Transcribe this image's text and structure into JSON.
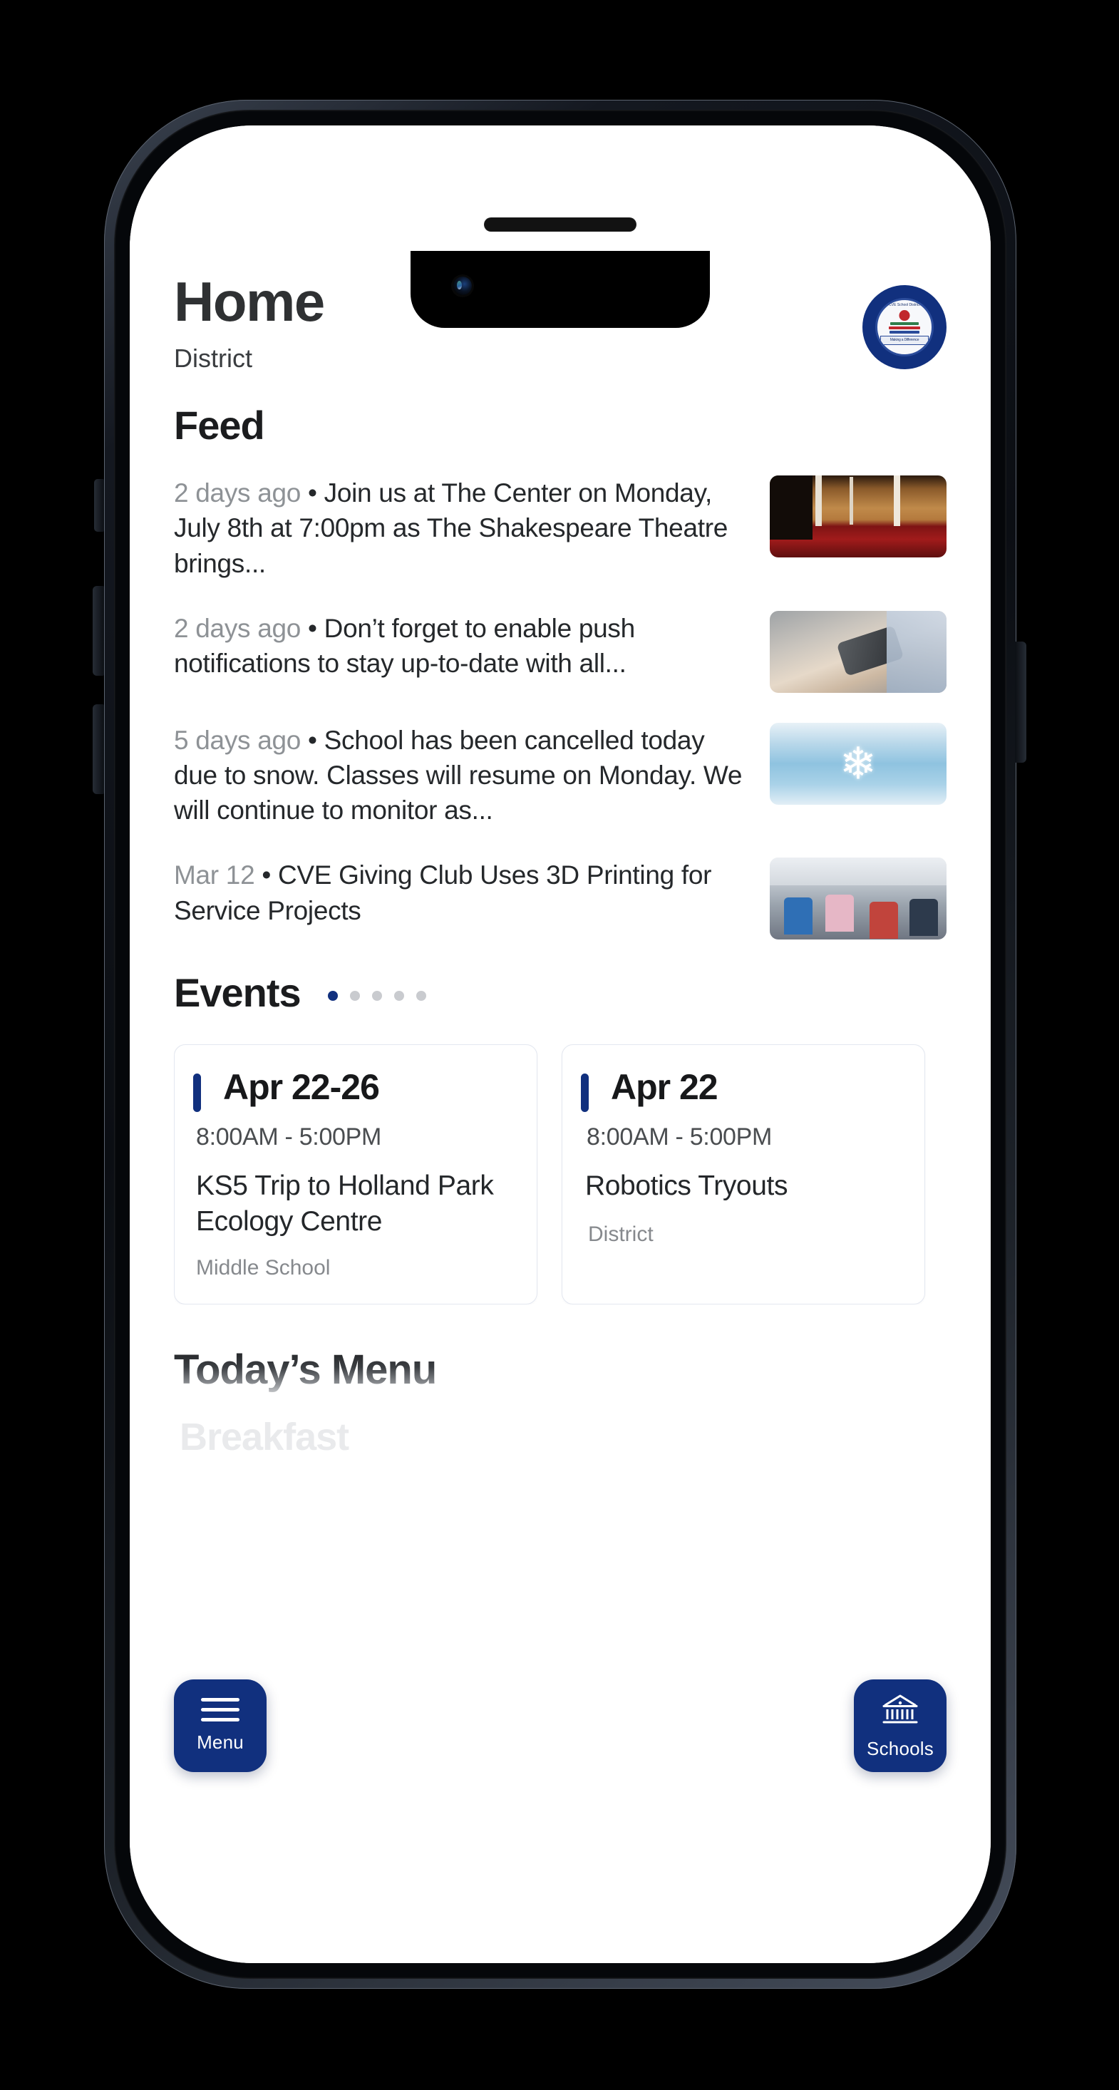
{
  "app": {
    "header": {
      "title": "Home",
      "subtitle": "District",
      "avatar_icon": "school-crest-logo",
      "crest_arc_text": "CVE School District",
      "crest_banner_text": "Making a Difference"
    },
    "feed": {
      "section_title": "Feed",
      "bullet": "•",
      "items": [
        {
          "date": "2 days ago",
          "text": "Join us at The Center on Monday, July 8th at 7:00pm as The Shakespeare Theatre brings...",
          "thumb_icon": "theatre-auditorium-thumbnail"
        },
        {
          "date": "2 days ago",
          "text": "Don’t forget to enable push notifications to stay up-to-date with all...",
          "thumb_icon": "hands-holding-phone-thumbnail"
        },
        {
          "date": "5 days ago",
          "text": "School has been cancelled today due to snow. Classes will resume on Monday. We will continue to monitor as...",
          "thumb_icon": "snowflake-mittens-thumbnail"
        },
        {
          "date": "Mar 12",
          "text": "CVE Giving Club Uses 3D Printing for Service Projects",
          "thumb_icon": "classroom-students-thumbnail"
        }
      ]
    },
    "events": {
      "section_title": "Events",
      "pagination": {
        "total": 5,
        "active_index": 0
      },
      "cards": [
        {
          "date": "Apr 22-26",
          "time": "8:00AM  -  5:00PM",
          "name": "KS5 Trip to Holland Park Ecology Centre",
          "scope": "Middle School"
        },
        {
          "date": "Apr 22",
          "time": "8:00AM  -  5:00PM",
          "name": "Robotics Tryouts",
          "scope": "District"
        }
      ]
    },
    "todays_menu": {
      "section_title": "Today’s Menu",
      "meal_label": "Breakfast"
    },
    "fab": {
      "menu_label": "Menu",
      "menu_icon": "hamburger-icon",
      "schools_label": "Schools",
      "schools_icon": "school-building-icon"
    },
    "colors": {
      "brand_blue": "#11307e",
      "accent_blue": "#11307e",
      "text_primary": "#1b1c1e",
      "text_muted": "#8e9296",
      "card_border": "#e3e7f0"
    }
  }
}
